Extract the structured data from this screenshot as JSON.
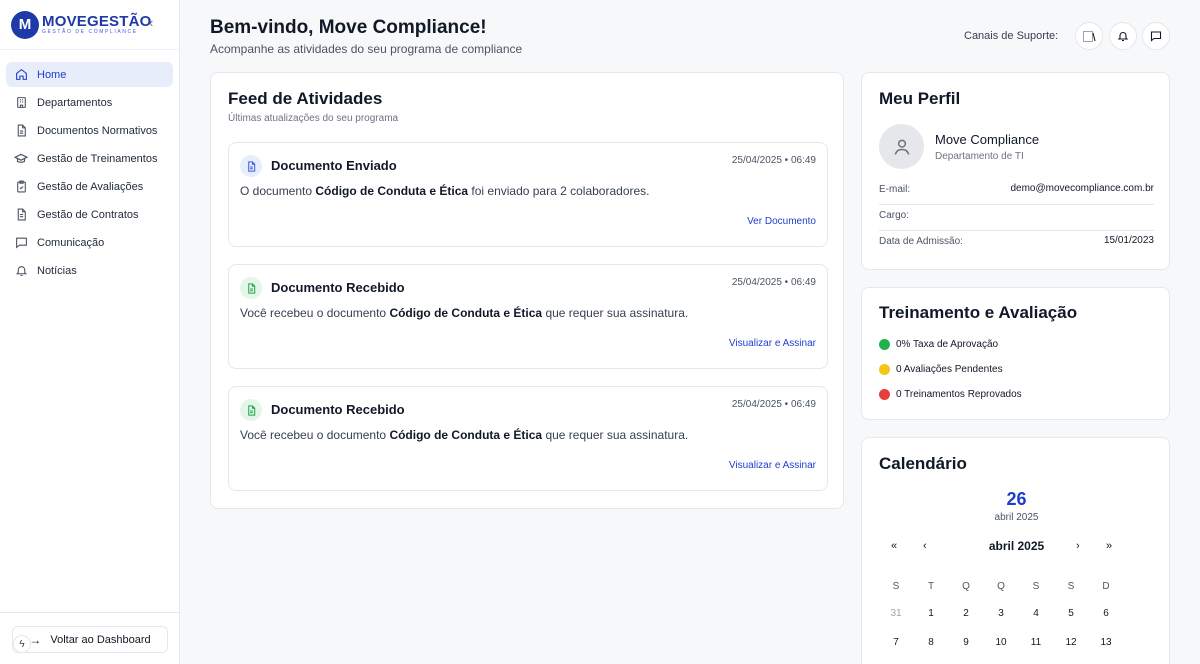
{
  "brand": {
    "badge": "M",
    "title": "MOVEGESTÃO",
    "subtitle": "GESTÃO DE COMPLIANCE",
    "collapse_icon": "chevron-left-icon"
  },
  "sidebar": {
    "items": [
      {
        "label": "Home",
        "icon": "home-icon",
        "active": true
      },
      {
        "label": "Departamentos",
        "icon": "building-icon"
      },
      {
        "label": "Documentos Normativos",
        "icon": "document-icon"
      },
      {
        "label": "Gestão de Treinamentos",
        "icon": "graduation-cap-icon"
      },
      {
        "label": "Gestão de Avaliações",
        "icon": "clipboard-check-icon"
      },
      {
        "label": "Gestão de Contratos",
        "icon": "file-text-icon"
      },
      {
        "label": "Comunicação",
        "icon": "message-icon"
      },
      {
        "label": "Notícias",
        "icon": "bell-icon"
      }
    ],
    "back_label": "Voltar ao Dashboard"
  },
  "header": {
    "title": "Bem-vindo, Move Compliance!",
    "subtitle": "Acompanhe as atividades do seu programa de compliance",
    "support_label": "Canais de Suporte:"
  },
  "feed": {
    "title": "Feed de Atividades",
    "subtitle": "Últimas atualizações do seu programa",
    "items": [
      {
        "title": "Documento Enviado",
        "date": "25/04/2025 • 06:49",
        "text_before": "O documento ",
        "doc": "Código de Conduta e Ética",
        "text_after": " foi enviado para 2 colaboradores.",
        "link": "Ver Documento",
        "color": "#3b5bd6"
      },
      {
        "title": "Documento Recebido",
        "date": "25/04/2025 • 06:49",
        "text_before": "Você recebeu o documento ",
        "doc": "Código de Conduta e Ética",
        "text_after": " que requer sua assinatura.",
        "link": "Visualizar e Assinar",
        "color": "#22a347"
      },
      {
        "title": "Documento Recebido",
        "date": "25/04/2025 • 06:49",
        "text_before": "Você recebeu o documento ",
        "doc": "Código de Conduta e Ética",
        "text_after": " que requer sua assinatura.",
        "link": "Visualizar e Assinar",
        "color": "#22a347"
      }
    ]
  },
  "profile": {
    "title": "Meu Perfil",
    "name": "Move Compliance",
    "department": "Departamento de TI",
    "rows": [
      {
        "label": "E-mail:",
        "value": "demo@movecompliance.com.br"
      },
      {
        "label": "Cargo:",
        "value": ""
      },
      {
        "label": "Data de Admissão:",
        "value": "15/01/2023"
      }
    ]
  },
  "training": {
    "title": "Treinamento e Avaliação",
    "stats": [
      {
        "label": "0% Taxa de Aprovação",
        "color": "#22b14c"
      },
      {
        "label": "0 Avaliações Pendentes",
        "color": "#f5c518"
      },
      {
        "label": "0 Treinamentos Reprovados",
        "color": "#e5403a"
      }
    ]
  },
  "calendar": {
    "title": "Calendário",
    "selected_day": "26",
    "selected_month": "abril 2025",
    "month_label": "abril 2025",
    "nav": [
      "«",
      "‹",
      "›",
      "»"
    ],
    "weekdays": [
      "S",
      "T",
      "Q",
      "Q",
      "S",
      "S",
      "D"
    ],
    "weeks": [
      [
        "31",
        "1",
        "2",
        "3",
        "4",
        "5",
        "6"
      ],
      [
        "7",
        "8",
        "9",
        "10",
        "11",
        "12",
        "13"
      ]
    ]
  }
}
